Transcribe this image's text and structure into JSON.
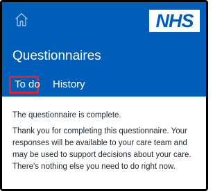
{
  "header": {
    "home_icon": "home-icon",
    "logo_text": "NHS",
    "title": "Questionnaires",
    "colors": {
      "header_bg": "#005eb8",
      "logo_text": "#005eb8",
      "active_tab_border": "#e5202b"
    }
  },
  "tabs": [
    {
      "label": "To do",
      "selected": true
    },
    {
      "label": "History",
      "selected": false
    }
  ],
  "content": {
    "status": "The questionnaire is complete.",
    "message_lines": [
      "Thank you for completing this questionnaire. Your",
      "responses will be available to your care team and",
      "may be used to support decisions about your care.",
      "There's nothing else you need to do right now."
    ]
  }
}
